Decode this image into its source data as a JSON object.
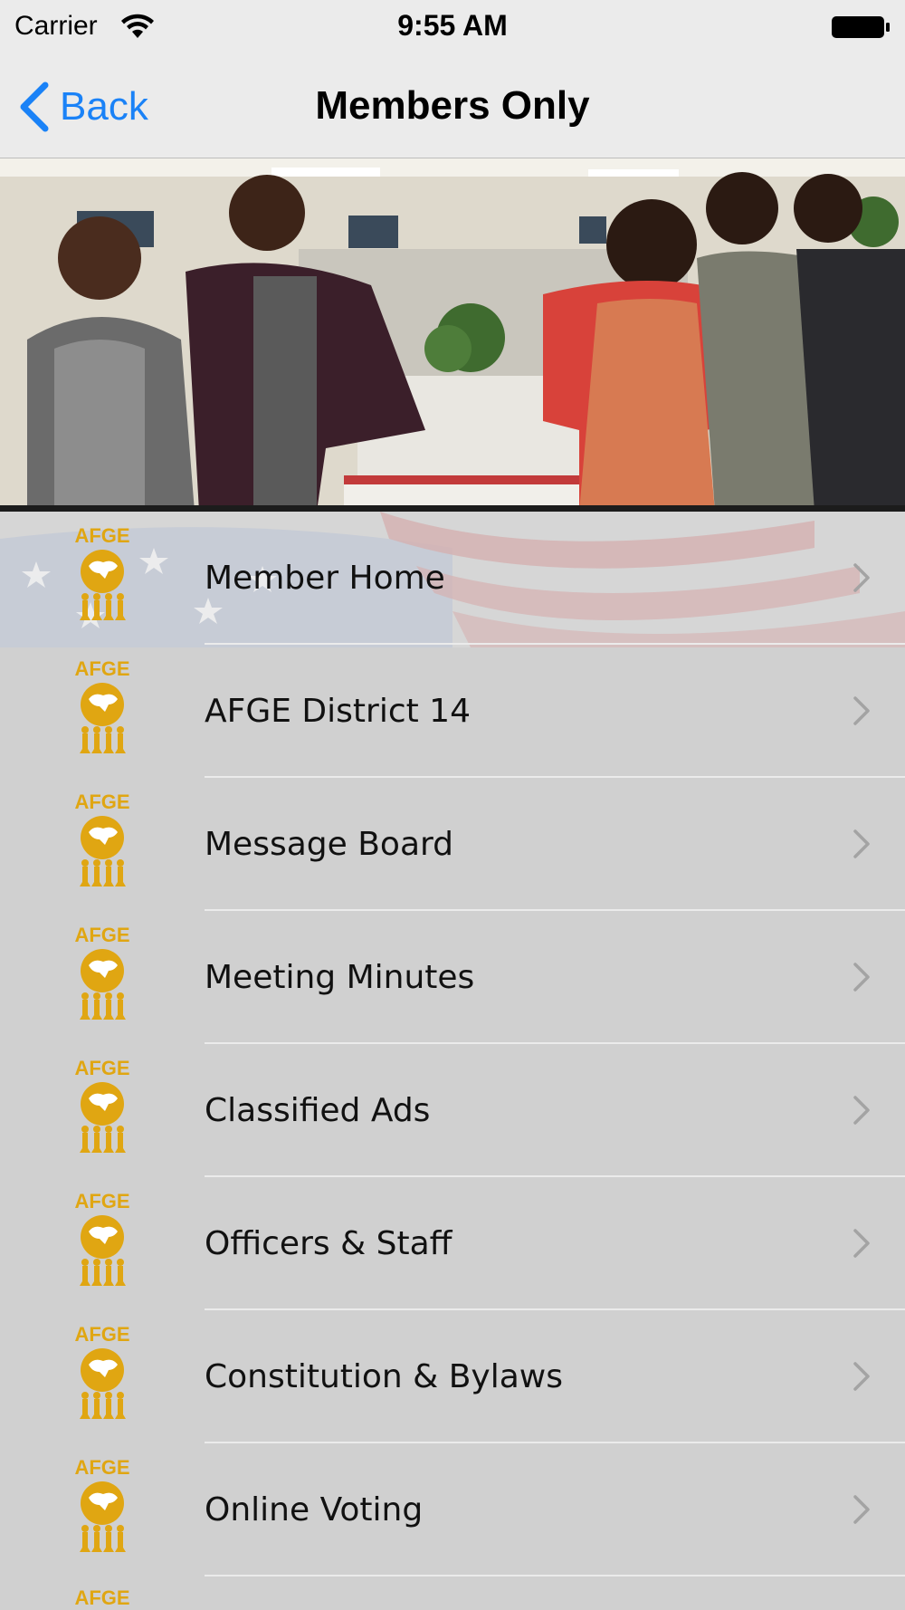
{
  "status_bar": {
    "carrier": "Carrier",
    "time": "9:55 AM"
  },
  "nav": {
    "back_label": "Back",
    "title": "Members Only"
  },
  "logo": {
    "text": "AFGE",
    "color": "#e0a612"
  },
  "menu": {
    "items": [
      {
        "label": "Member Home"
      },
      {
        "label": "AFGE District 14"
      },
      {
        "label": "Message Board"
      },
      {
        "label": "Meeting Minutes"
      },
      {
        "label": "Classified Ads"
      },
      {
        "label": "Officers & Staff"
      },
      {
        "label": "Constitution & Bylaws"
      },
      {
        "label": "Online Voting"
      }
    ]
  },
  "colors": {
    "accent": "#1a82f7",
    "list_background": "#d0d0d0",
    "bar_background": "#ebebeb"
  }
}
